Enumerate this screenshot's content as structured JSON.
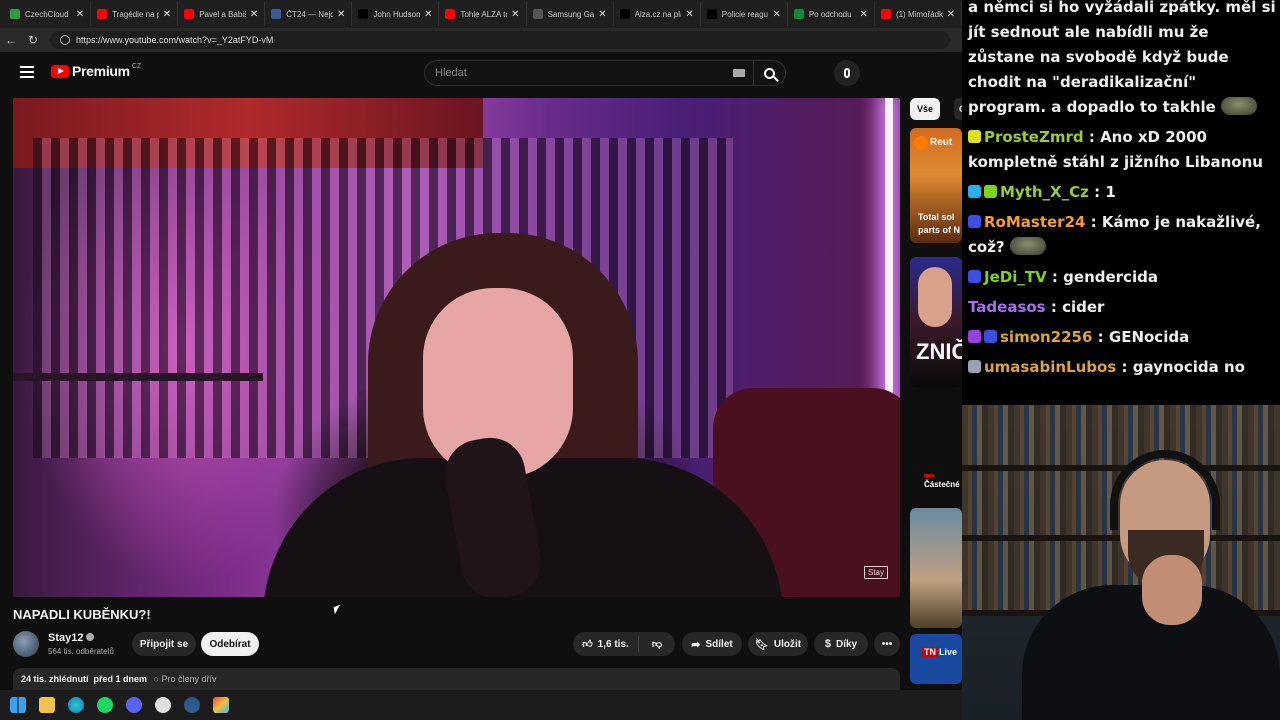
{
  "browser": {
    "tabs": [
      {
        "label": "CzechCloud",
        "color": "#2e9b3f"
      },
      {
        "label": "Tragédie na p",
        "color": "#ff0000"
      },
      {
        "label": "Pavel a Babiš",
        "color": "#ff0000"
      },
      {
        "label": "ČT24 — Nejd",
        "color": "#3b5998"
      },
      {
        "label": "John Hudson",
        "color": "#000000"
      },
      {
        "label": "Tohle ALZA to",
        "color": "#ff0000"
      },
      {
        "label": "Samsung Gal",
        "color": "#555555"
      },
      {
        "label": "Alza.cz na pla",
        "color": "#000000"
      },
      {
        "label": "Policie reagu",
        "color": "#000000"
      },
      {
        "label": "Po odchodu",
        "color": "#0b8a3a"
      },
      {
        "label": "(1) Mimořádk",
        "color": "#ff0000"
      }
    ],
    "tab_close": "✕",
    "url": "https://www.youtube.com/watch?v=_Y2atFYD-vM"
  },
  "youtube": {
    "logo_text": "Premium",
    "logo_region": "CZ",
    "search_placeholder": "Hledat",
    "video_title": "NAPADLI KUBĚNKU?!",
    "video_watermark": "Stay",
    "channel_name": "Stay12",
    "channel_subs": "564 tis. odběratelů",
    "join_label": "Připojit se",
    "subscribe_label": "Odebírat",
    "like_count": "1,6 tis.",
    "share_label": "Sdílet",
    "save_label": "Uložit",
    "thanks_label": "Díky",
    "more_label": "•••",
    "description": {
      "views": "24 tis. zhlédnutí",
      "date": "před 1 dnem",
      "members": "Pro členy dřív"
    },
    "chips": [
      "Vše",
      "O"
    ],
    "side_texts": {
      "reuters": "Reut",
      "reuters_title_1": "Total sol",
      "reuters_title_2": "parts of N",
      "zni": "ZNIČ",
      "castecne": "Částečné",
      "tn_live": "Live"
    }
  },
  "chat": {
    "messages": [
      {
        "user": "",
        "user_color": "#efefef",
        "badges": [],
        "text": "a němci si ho vyžádali zpátky. měl si jít sednout ale nabídli mu že zůstane na svobodě když bude chodit na \"deradikalizační\" program. a dopadlo to takhle",
        "emote": true
      },
      {
        "user": "ProsteZmrd",
        "user_color": "#9acd32",
        "badges": [
          "#e0e020"
        ],
        "text": "Ano xD 2000 kompletně stáhl z jižního Libanonu",
        "emote": false
      },
      {
        "user": "Myth_X_Cz",
        "user_color": "#9acd32",
        "badges": [
          "#2ab0e8",
          "#7ed321"
        ],
        "text": "1",
        "emote": false
      },
      {
        "user": "RoMaster24",
        "user_color": "#f59e30",
        "badges": [
          "#3b4fe0"
        ],
        "text": "Kámo je nakažlivé, což?",
        "emote": true
      },
      {
        "user": "JeDi_TV",
        "user_color": "#7ed321",
        "badges": [
          "#3b4fe0"
        ],
        "text": "gendercida",
        "emote": false
      },
      {
        "user": "Tadeasos",
        "user_color": "#a86ef0",
        "badges": [],
        "text": "cider",
        "emote": false
      },
      {
        "user": "simon2256",
        "user_color": "#d9a441",
        "badges": [
          "#9a40e0",
          "#3b4fe0"
        ],
        "text": "GENocida",
        "emote": false
      },
      {
        "user": "umasabinLubos",
        "user_color": "#d9a441",
        "badges": [
          "#9aa0b0"
        ],
        "text": "gaynocida no",
        "emote": false
      }
    ]
  },
  "taskbar": {
    "icons": [
      "windows",
      "files",
      "edge",
      "spotify",
      "discord",
      "obs",
      "steam",
      "photos"
    ]
  }
}
